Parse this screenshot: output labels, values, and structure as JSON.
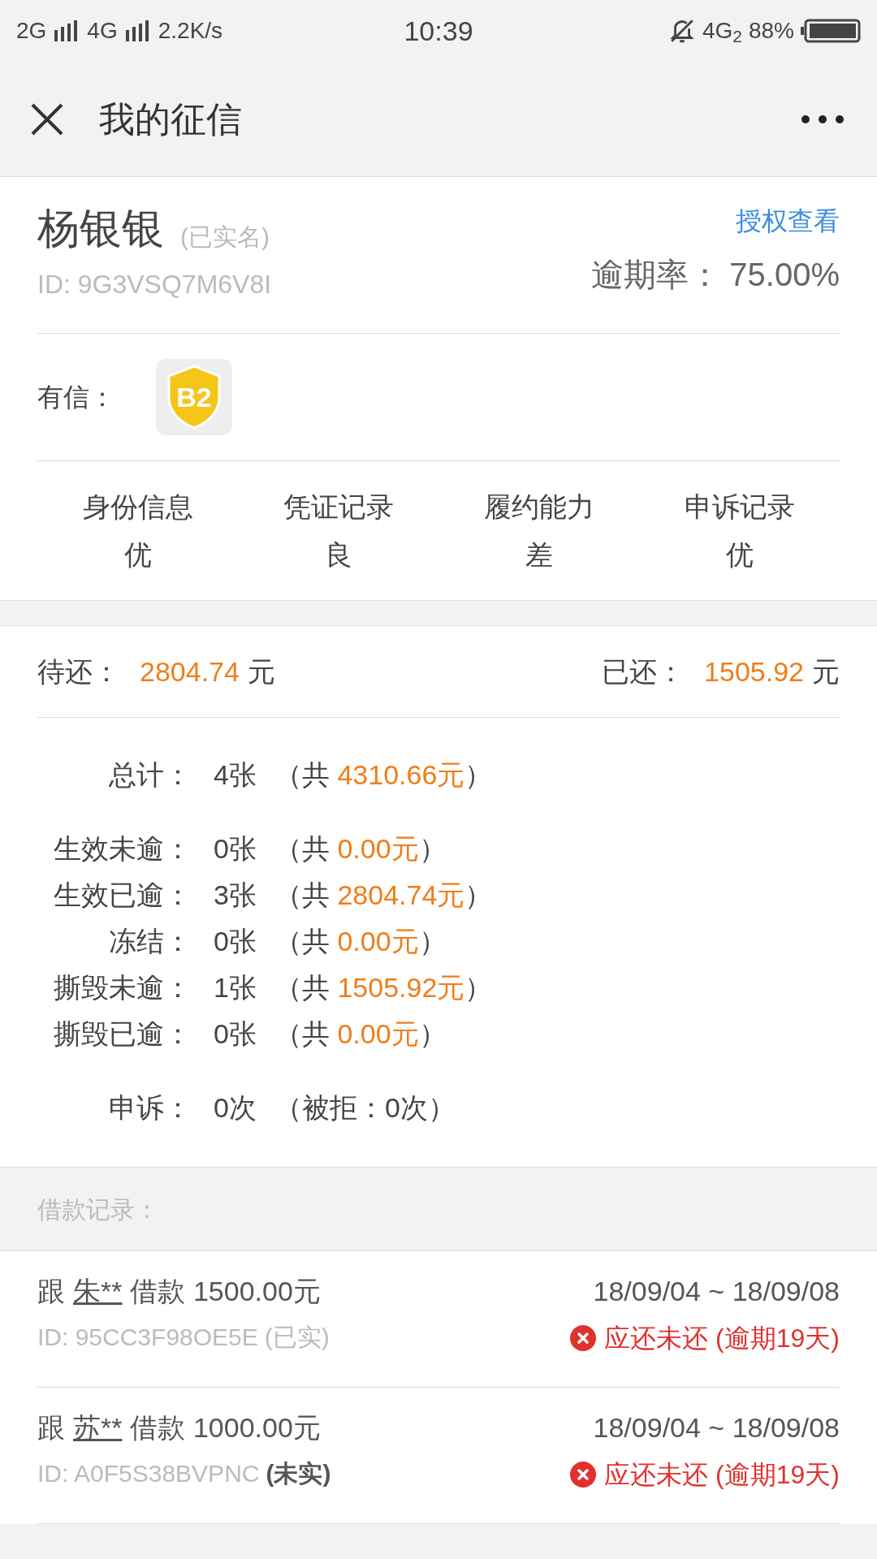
{
  "status_bar": {
    "left": [
      {
        "kind": "text",
        "text": "2G"
      },
      {
        "kind": "signal"
      },
      {
        "kind": "text",
        "text": "4G"
      },
      {
        "kind": "signal"
      },
      {
        "kind": "text",
        "text": "2.2K/s"
      }
    ],
    "time": "10:39",
    "network": "4G$_{2}$",
    "battery": "88%"
  },
  "header": {
    "title": "我的征信"
  },
  "profile": {
    "name": "杨银银",
    "verified_label": "(已实名)",
    "id": "ID: 9G3VSQ7M6V8I",
    "link": "授权查看",
    "overdue_rate_label": "逾期率：",
    "overdue_rate": "75.00%"
  },
  "credit": {
    "label": "有信：",
    "badge": "B2"
  },
  "ratings": [
    {
      "label": "身份信息",
      "value": "优"
    },
    {
      "label": "凭证记录",
      "value": "良"
    },
    {
      "label": "履约能力",
      "value": "差"
    },
    {
      "label": "申诉记录",
      "value": "优"
    }
  ],
  "balance": {
    "pending_label": "待还：",
    "pending": "2804.74",
    "pending_unit": "元",
    "paid_label": "已还：",
    "paid": "1505.92",
    "paid_unit": "元"
  },
  "stats": [
    {
      "kind": "total",
      "label": "总计：",
      "count": "4张",
      "open": "（共",
      "amount": "4310.66元",
      "close": "）"
    },
    {
      "kind": "row",
      "label": "生效未逾：",
      "count": "0张",
      "open": "（共",
      "amount": "0.00元",
      "close": "）"
    },
    {
      "kind": "row",
      "label": "生效已逾：",
      "count": "3张",
      "open": "（共",
      "amount": "2804.74元",
      "close": "）"
    },
    {
      "kind": "row",
      "label": "冻结：",
      "count": "0张",
      "open": "（共",
      "amount": "0.00元",
      "close": "）"
    },
    {
      "kind": "row",
      "label": "撕毁未逾：",
      "count": "1张",
      "open": "（共",
      "amount": "1505.92元",
      "close": "）"
    },
    {
      "kind": "row",
      "label": "撕毁已逾：",
      "count": "0张",
      "open": "（共",
      "amount": "0.00元",
      "close": "）"
    }
  ],
  "appeal": {
    "label": "申诉：",
    "count": "0次",
    "detail": "（被拒：0次）"
  },
  "records_header": "借款记录：",
  "records": [
    {
      "prefix": "跟",
      "lender": "朱**",
      "loan": "借款 1500.00元",
      "id": "ID: 95CC3F98OE5E",
      "tag": "(已实)",
      "verified": true,
      "dates": "18/09/04 ~ 18/09/08",
      "status": "应还未还 (逾期19天)"
    },
    {
      "prefix": "跟",
      "lender": "苏**",
      "loan": "借款 1000.00元",
      "id": "ID: A0F5S38BVPNC",
      "tag": "(未实)",
      "verified": false,
      "dates": "18/09/04 ~ 18/09/08",
      "status": "应还未还 (逾期19天)"
    }
  ]
}
